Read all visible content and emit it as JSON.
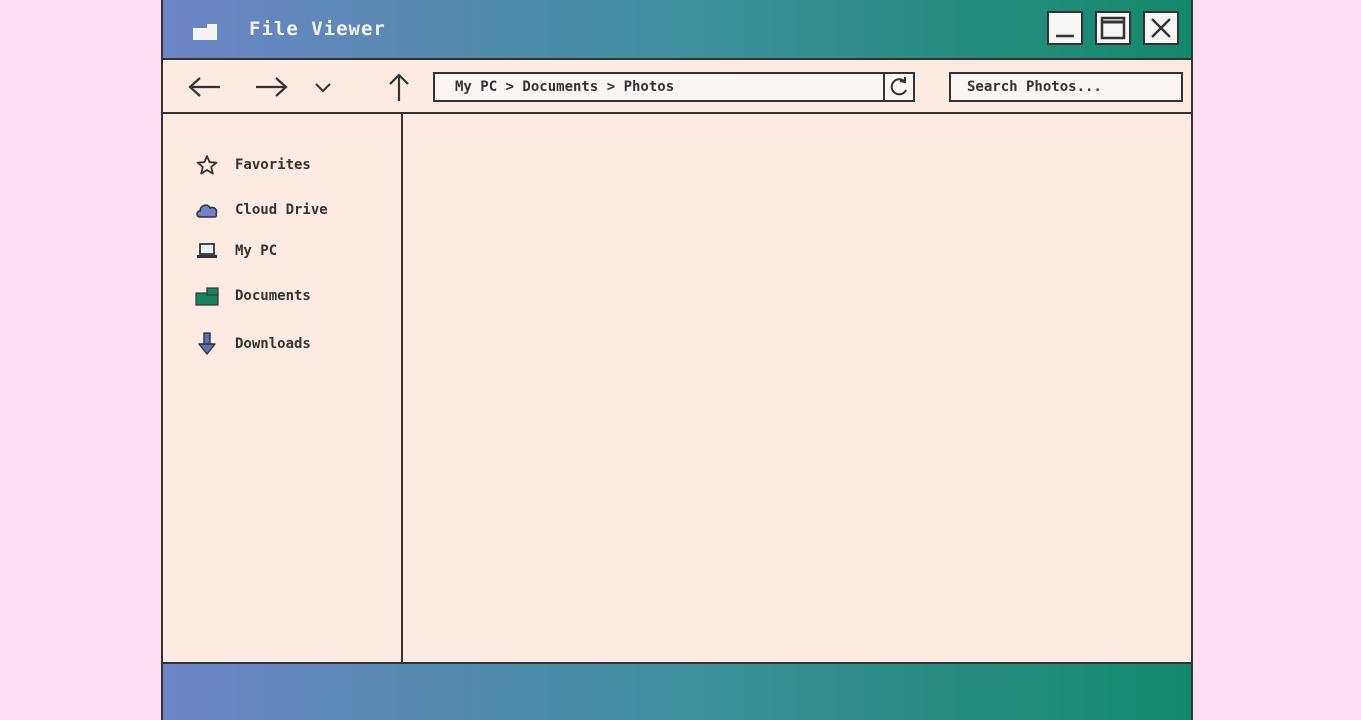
{
  "app": {
    "title": "File Viewer"
  },
  "window_controls": {
    "minimize_icon": "minimize-icon",
    "maximize_icon": "maximize-icon",
    "close_icon": "close-icon"
  },
  "toolbar": {
    "back_icon": "arrow-left-icon",
    "forward_icon": "arrow-right-icon",
    "recent_icon": "chevron-down-icon",
    "up_icon": "arrow-up-icon",
    "refresh_icon": "refresh-icon"
  },
  "address": {
    "path": "My PC > Documents > Photos",
    "dropdown_icon": "chevron-down-icon"
  },
  "search": {
    "placeholder": "Search Photos..."
  },
  "sidebar": {
    "items": [
      {
        "label": "Favorites",
        "icon": "star-icon"
      },
      {
        "label": "Cloud Drive",
        "icon": "cloud-icon"
      },
      {
        "label": "My PC",
        "icon": "laptop-icon"
      },
      {
        "label": "Documents",
        "icon": "folder-icon"
      },
      {
        "label": "Downloads",
        "icon": "download-arrow-icon"
      }
    ]
  },
  "colors": {
    "titlebar_start": "#6e84c6",
    "titlebar_end": "#12896a",
    "window_bg": "#fdeae2",
    "page_bg": "#fcdff2"
  }
}
